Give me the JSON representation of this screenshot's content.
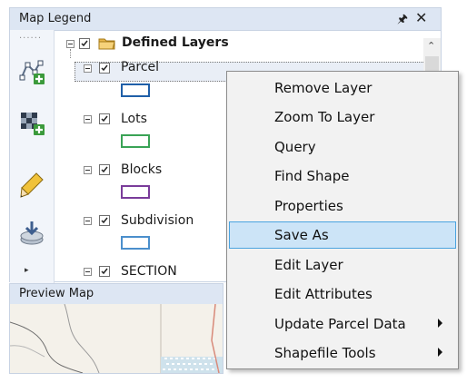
{
  "legend": {
    "title": "Map Legend",
    "pin_icon": "pin-icon",
    "close_icon": "close-icon",
    "root": {
      "label": "Defined Layers",
      "checked": true,
      "icon": "folder-icon"
    },
    "layers": [
      {
        "label": "Parcel",
        "checked": true,
        "swatch_color": "#1f5fa8",
        "selected": true
      },
      {
        "label": "Lots",
        "checked": true,
        "swatch_color": "#3aa356"
      },
      {
        "label": "Blocks",
        "checked": true,
        "swatch_color": "#7a3c9a"
      },
      {
        "label": "Subdivision",
        "checked": true,
        "swatch_color": "#4b8fcc"
      },
      {
        "label": "SECTION",
        "checked": true
      }
    ],
    "tools": [
      "add-vertex-layer-icon",
      "add-raster-layer-icon",
      "pencil-icon",
      "download-layer-icon"
    ]
  },
  "preview": {
    "title": "Preview Map"
  },
  "context_menu": {
    "items": [
      {
        "label": "Remove Layer",
        "submenu": false
      },
      {
        "label": "Zoom To Layer",
        "submenu": false
      },
      {
        "label": "Query",
        "submenu": false
      },
      {
        "label": "Find Shape",
        "submenu": false
      },
      {
        "label": "Properties",
        "submenu": false
      },
      {
        "label": "Save As",
        "submenu": false,
        "highlighted": true
      },
      {
        "label": "Edit Layer",
        "submenu": false
      },
      {
        "label": "Edit Attributes",
        "submenu": false
      },
      {
        "label": "Update Parcel Data",
        "submenu": true
      },
      {
        "label": "Shapefile Tools",
        "submenu": true
      }
    ]
  },
  "colors": {
    "header_bg": "#dde6f3",
    "menu_bg": "#f2f2f2",
    "highlight_bg": "#cce4f7",
    "highlight_border": "#4aa3df"
  }
}
